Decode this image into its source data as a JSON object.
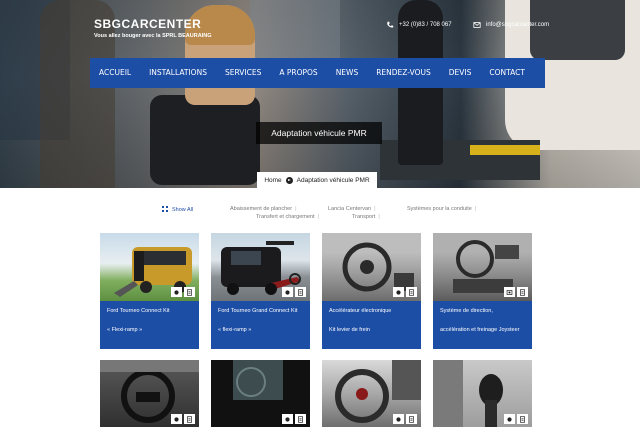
{
  "brand": {
    "name": "SBGCARCENTER",
    "tagline": "Vous allez bouger avec la SPRL BEAURAING"
  },
  "contact": {
    "phone": "+32 (0)83 / 708 067",
    "email": "info@sbgcarcenter.com"
  },
  "nav": [
    "ACCUEIL",
    "INSTALLATIONS",
    "SERVICES",
    "A PROPOS",
    "NEWS",
    "RENDEZ-VOUS",
    "DEVIS",
    "CONTACT"
  ],
  "hero": {
    "title": "Adaptation véhicule PMR"
  },
  "breadcrumb": {
    "home": "Home",
    "current": "Adaptation véhicule PMR"
  },
  "filters": {
    "show_all": "Show All",
    "items": [
      "Abaissement de plancher",
      "Lancia Centervan",
      "Systèmes pour la conduite",
      "Transfert et chargement",
      "Transport"
    ]
  },
  "cards": [
    {
      "title": "Ford Tourneo Connect Kit",
      "desc": "« Flexi-ramp »",
      "image": "van-ramp"
    },
    {
      "title": "Ford Tourneo Grand Connect Kit",
      "desc": "« flexi-ramp »",
      "image": "van-wheelchair"
    },
    {
      "title": "Accélérateur électronique",
      "desc": "Kit levier de frein",
      "image": "dashboard"
    },
    {
      "title": "Système de direction,",
      "desc": "accélération et freinage Joysteer",
      "image": "joystick-dashboard"
    }
  ],
  "cards_row2": [
    {
      "image": "steering-wheel"
    },
    {
      "image": "black-interior"
    },
    {
      "image": "fiat-steering"
    },
    {
      "image": "gear-knob"
    }
  ],
  "colors": {
    "accent": "#1d4ea6"
  },
  "icons": {
    "phone": "phone-icon",
    "mail": "mail-icon",
    "zoom": "zoom-icon",
    "doc": "document-icon"
  }
}
